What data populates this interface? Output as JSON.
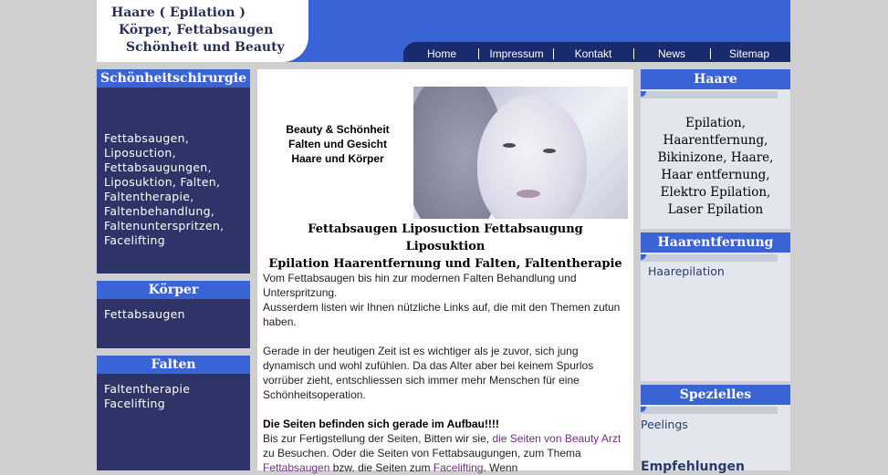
{
  "header": {
    "logo_lines": [
      "Haare ( Epilation )",
      "Körper, Fettabsaugen",
      "Schönheit und Beauty"
    ],
    "nav": [
      "Home",
      "Impressum",
      "Kontakt",
      "News",
      "Sitemap"
    ]
  },
  "left": {
    "sections": [
      {
        "title": "Schönheitschirurgie",
        "items": [
          "Fettabsaugen,",
          "Liposuction,",
          "Fettabsaugungen,",
          "Liposuktion, Falten,",
          "Faltentherapie,",
          "Faltenbehandlung,",
          "Faltenunterspritzen,",
          "Facelifting"
        ]
      },
      {
        "title": "Körper",
        "items": [
          "Fettabsaugen"
        ]
      },
      {
        "title": "Falten",
        "items": [
          "Faltentherapie",
          "Facelifting"
        ]
      }
    ]
  },
  "main": {
    "intro": [
      "Beauty & Schönheit",
      "Falten und Gesicht",
      "Haare und Körper"
    ],
    "title_lines": [
      "Fettabsaugen Liposuction Fettabsaugung Liposuktion",
      "Epilation Haarentfernung und Falten, Faltentherapie"
    ],
    "para1": "Vom Fettabsaugen bis hin zur modernen Falten Behandlung und Unterspritzung.",
    "para1b": "Ausserdem listen wir Ihnen nützliche Links auf, die mit den Themen zutun haben.",
    "para2": "Gerade in der heutigen Zeit ist es wichtiger als je zuvor, sich jung dynamisch und wohl zufühlen. Da das Alter aber bei keinem Spurlos vorrüber zieht, entschliessen sich immer mehr Menschen für eine Schönheitsoperation.",
    "notice": "Die Seiten befinden sich gerade im Aufbau!!!!",
    "para3_a": "Bis zur Fertigstellung der Seiten, Bitten wir sie, ",
    "para3_link1": "die Seiten von Beauty Arzt",
    "para3_b": " zu Besuchen. Oder die Seiten von Fettabsaugungen, zum Thema ",
    "para3_link2": "Fettabsaugen",
    "para3_c": " bzw. die Seiten zum ",
    "para3_link3": "Facelifting",
    "para3_d": ". Wenn"
  },
  "right": {
    "haare_title": "Haare",
    "haare_text": "Epilation, Haarentfernung, Bikinizone, Haare, Haar entfernung, Elektro Epilation, Laser Epilation",
    "haarentfernung_title": "Haarentfernung",
    "haarentfernung_link": "Haarepilation",
    "spezielles_title": "Spezielles",
    "spezielles_link": "Peelings",
    "empfehlungen": "Empfehlungen"
  }
}
